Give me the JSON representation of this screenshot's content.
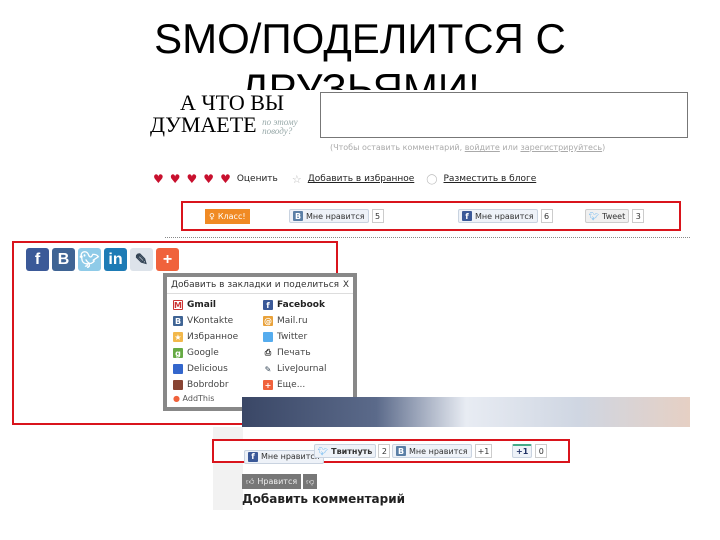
{
  "slide": {
    "title_line1": "SMO/ПОДЕЛИТСЯ С",
    "title_line2": "ДРУЗЬЯМИ!"
  },
  "top": {
    "heading1": "А ЧТО ВЫ",
    "heading2": "ДУМАЕТЕ",
    "heading_sub1": "по этому",
    "heading_sub2": "поводу?",
    "comment_hint_pre": "(Чтобы оставить комментарий, ",
    "login_link": "войдите",
    "or": " или ",
    "register_link": "зарегистрируйтесь",
    "comment_hint_post": ")",
    "rate_label": "Оценить",
    "hearts": 5,
    "favorite_link": "Добавить в избранное",
    "blog_link": "Разместить в блоге",
    "share": {
      "ok_label": "Класс!",
      "vk_label": "Мне нравится",
      "vk_count": "5",
      "fb_label": "Мне нравится",
      "fb_count": "6",
      "tw_label": "Tweet",
      "tw_count": "3"
    }
  },
  "addthis": {
    "icons": [
      "facebook-icon",
      "vkontakte-icon",
      "twitter-icon",
      "linkedin-icon",
      "livejournal-icon",
      "more-icon"
    ],
    "popup_title": "Добавить в закладки и поделиться",
    "close": "X",
    "left": [
      "Gmail",
      "VKontakte",
      "Избранное",
      "Google",
      "Delicious",
      "Bobrdobr"
    ],
    "right": [
      "Facebook",
      "Mail.ru",
      "Twitter",
      "Печать",
      "LiveJournal",
      "Еще..."
    ],
    "footer": "AddThis"
  },
  "bottom": {
    "fb_label": "Мне нравится",
    "tw_label": "Твитнуть",
    "tw_count": "2",
    "vk_label": "Мне нравится",
    "vk_count": "+1",
    "gplus_label": "+1",
    "gplus_count": "0",
    "like_label": "Нравится",
    "add_comment": "Добавить комментарий"
  },
  "colors": {
    "highlight": "#d9141c",
    "heart": "#c8102e",
    "ok": "#f08a24",
    "vk": "#5b7fa6",
    "fb": "#3b5998",
    "tw": "#55acee"
  }
}
